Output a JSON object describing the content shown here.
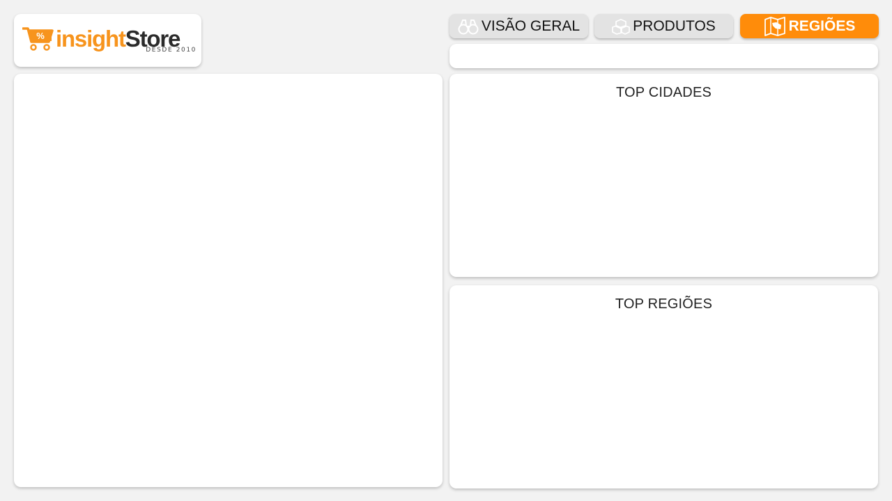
{
  "brand": {
    "name_part1": "insight",
    "name_part2": "Store",
    "tagline": "DESDE 2010",
    "cart_badge": "%",
    "accent_color": "#f7941d"
  },
  "tabs": [
    {
      "label": "VISÃO GERAL",
      "icon": "binoculars-icon",
      "active": false
    },
    {
      "label": "PRODUTOS",
      "icon": "boxes-icon",
      "active": false
    },
    {
      "label": "REGIÕES",
      "icon": "map-icon",
      "active": true
    }
  ],
  "active_tab_color": "#ff8c0a",
  "panels": {
    "top_cities_title": "TOP CIDADES",
    "top_regions_title": "TOP REGIÕES"
  }
}
